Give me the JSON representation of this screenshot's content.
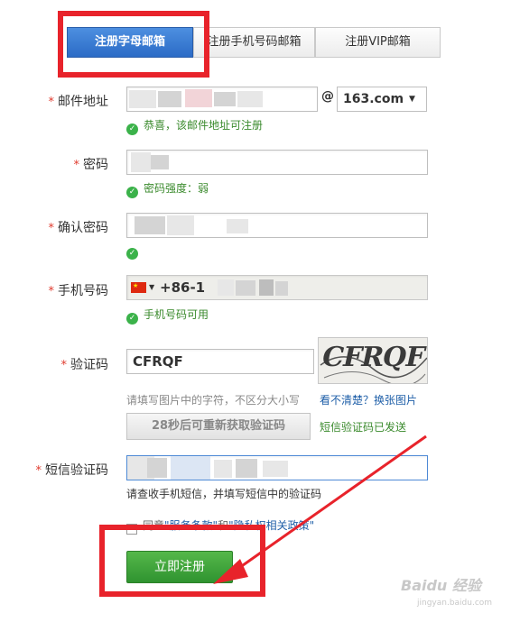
{
  "tabs": [
    "注册字母邮箱",
    "注册手机号码邮箱",
    "注册VIP邮箱"
  ],
  "required_mark": "*",
  "email": {
    "label": "邮件地址",
    "at": "@",
    "domain": "163.com",
    "hint": "恭喜，该邮件地址可注册"
  },
  "password": {
    "label": "密码",
    "hint": "密码强度：弱"
  },
  "confirm_password": {
    "label": "确认密码"
  },
  "phone": {
    "label": "手机号码",
    "country_code": "+86-1",
    "hint": "手机号码可用"
  },
  "captcha": {
    "label": "验证码",
    "value": "CFRQF",
    "image_text": "CFRQF",
    "help": "请填写图片中的字符，不区分大小写",
    "refresh_link": "看不清楚？换张图片",
    "resend_button": "28秒后可重新获取验证码",
    "sent_status": "短信验证码已发送"
  },
  "sms_code": {
    "label": "短信验证码",
    "help": "请查收手机短信，并填写短信中的验证码"
  },
  "agreement": {
    "prefix": "同意",
    "terms": "\"服务条款\"",
    "conjunction": "和",
    "privacy": "\"隐私权相关政策\""
  },
  "submit_button": "立即注册",
  "watermark": "Baidu 经验",
  "watermark_url": "jingyan.baidu.com",
  "colors": {
    "accent_blue": "#2b6bc6",
    "success_green": "#3a8a2c",
    "submit_green": "#3a9f36",
    "annotation_red": "#e8232b",
    "required_red": "#e03b2e",
    "link_blue": "#1f5fa8"
  }
}
